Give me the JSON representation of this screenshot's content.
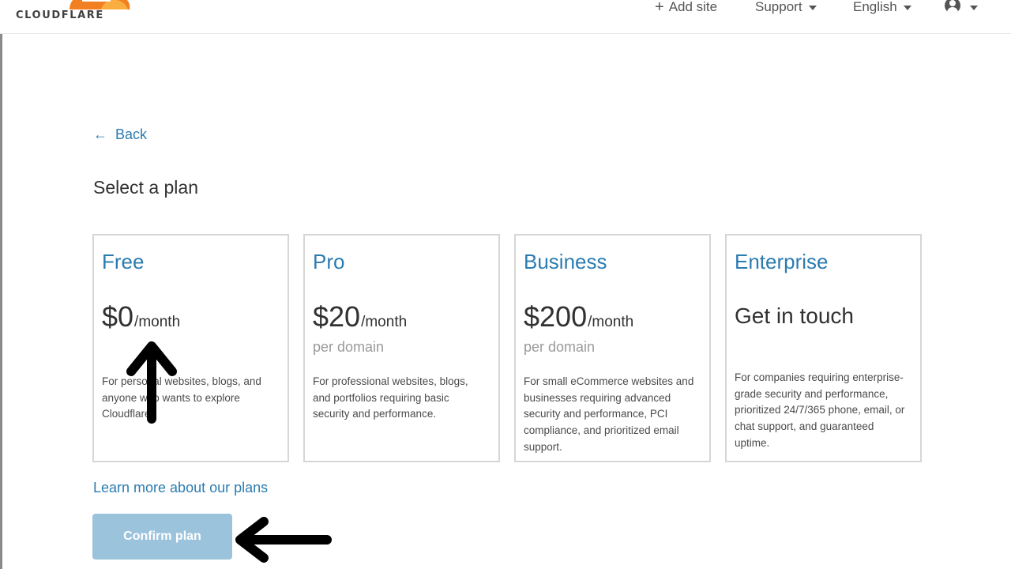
{
  "header": {
    "logo_text": "CLOUDFLARE",
    "add_site": "Add site",
    "support": "Support",
    "language": "English"
  },
  "back_label": "Back",
  "title": "Select a plan",
  "plans": [
    {
      "name": "Free",
      "price": "$0",
      "period": "/month",
      "description": "For personal websites, blogs, and anyone who wants to explore Cloudflare."
    },
    {
      "name": "Pro",
      "price": "$20",
      "period": "/month",
      "per": "per domain",
      "description": "For professional websites, blogs, and portfolios requiring basic security and performance."
    },
    {
      "name": "Business",
      "price": "$200",
      "period": "/month",
      "per": "per domain",
      "description": "For small eCommerce websites and businesses requiring advanced security and performance, PCI compliance, and prioritized email support."
    },
    {
      "name": "Enterprise",
      "price_text": "Get in touch",
      "description": "For companies requiring enterprise-grade security and performance, prioritized 24/7/365 phone, email, or chat support, and guaranteed uptime."
    }
  ],
  "learn_more": "Learn more about our plans",
  "confirm_label": "Confirm plan",
  "colors": {
    "accent": "#2c7cb0",
    "brand_orange": "#f38020",
    "confirm_disabled": "#9cc3dc",
    "annotation_arrow": "#000000"
  },
  "icons": [
    "cloudflare-logo",
    "plus-icon",
    "caret-down-icon",
    "user-icon",
    "back-arrow-icon"
  ]
}
